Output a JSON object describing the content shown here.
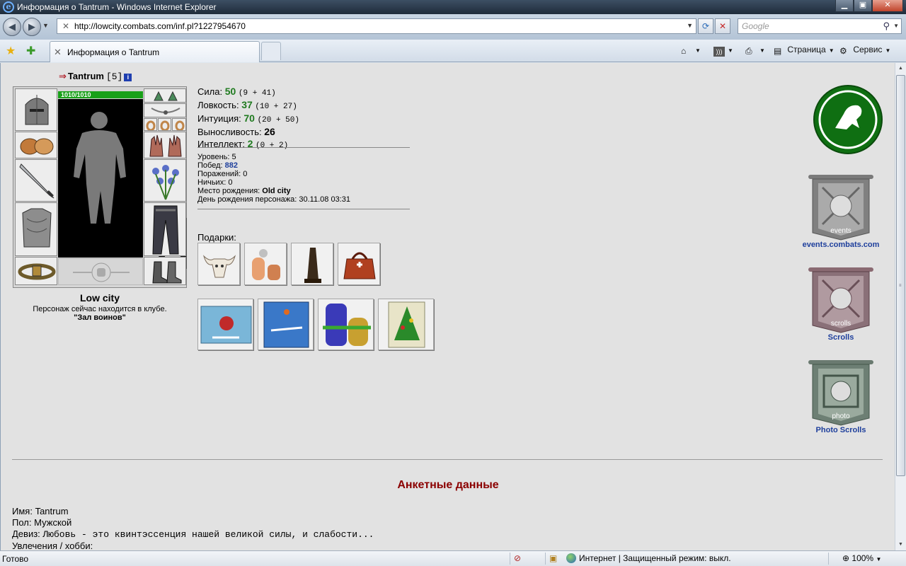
{
  "window": {
    "title": "Информация о Tantrum - Windows Internet Explorer",
    "minimize": "▁",
    "maximize": "▣",
    "close": "✕"
  },
  "browser": {
    "url": "http://lowcity.combats.com/inf.pl?1227954670",
    "search_placeholder": "Google",
    "tab_label": "Информация о Tantrum",
    "commands": {
      "page": "Страница",
      "tools": "Сервис"
    },
    "icons": [
      "back-icon",
      "forward-icon",
      "refresh-icon",
      "stop-icon",
      "search-icon",
      "favorites-star-icon",
      "add-favorites-icon",
      "home-icon",
      "feeds-icon",
      "print-icon",
      "page-icon",
      "tools-gear-icon"
    ]
  },
  "character": {
    "name": "Tantrum",
    "level": "[5]",
    "hp": "1010/1010",
    "city": "Low city",
    "location_text": "Персонаж сейчас находится в клубе.",
    "room": "\"Зал воинов\""
  },
  "stats": [
    {
      "label": "Сила:",
      "value": "50",
      "detail": "(9 + 41)"
    },
    {
      "label": "Ловкость:",
      "value": "37",
      "detail": "(10 + 27)"
    },
    {
      "label": "Интуиция:",
      "value": "70",
      "detail": "(20 + 50)"
    },
    {
      "label": "Выносливость:",
      "value": "26",
      "detail": ""
    },
    {
      "label": "Интеллект:",
      "value": "2",
      "detail": "(0 + 2)"
    }
  ],
  "info": {
    "level_label": "Уровень:",
    "level": "5",
    "wins_label": "Побед:",
    "wins": "882",
    "losses_label": "Поражений:",
    "losses": "0",
    "draws_label": "Ничьих:",
    "draws": "0",
    "birthplace_label": "Место рождения:",
    "birthplace": "Old city",
    "birthday_label": "День рождения персонажа:",
    "birthday": "30.11.08 03:31"
  },
  "gifts_label": "Подарки:",
  "sidebar": {
    "events": "events.combats.com",
    "events_banner": "events",
    "scrolls": "Scrolls",
    "scrolls_banner": "scrolls",
    "photo": "Photo Scrolls",
    "photo_banner": "photo"
  },
  "profile": {
    "heading": "Анкетные данные",
    "name_label": "Имя:",
    "name": "Tantrum",
    "sex_label": "Пол:",
    "sex": "Мужской",
    "motto_label": "Девиз:",
    "motto": "Любовь - это квинтэссенция нашей великой силы, и слабости...",
    "hobby_label": "Увлечения / хобби:"
  },
  "status": {
    "left": "Готово",
    "zone": "Интернет | Защищенный режим: выкл.",
    "zoom": "100%"
  },
  "colors": {
    "stat_green": "#1f7a1f",
    "link_blue": "#1e3f9c",
    "heading_red": "#8b0000",
    "hp_green": "#19a019",
    "logo_green": "#0f6f12"
  }
}
